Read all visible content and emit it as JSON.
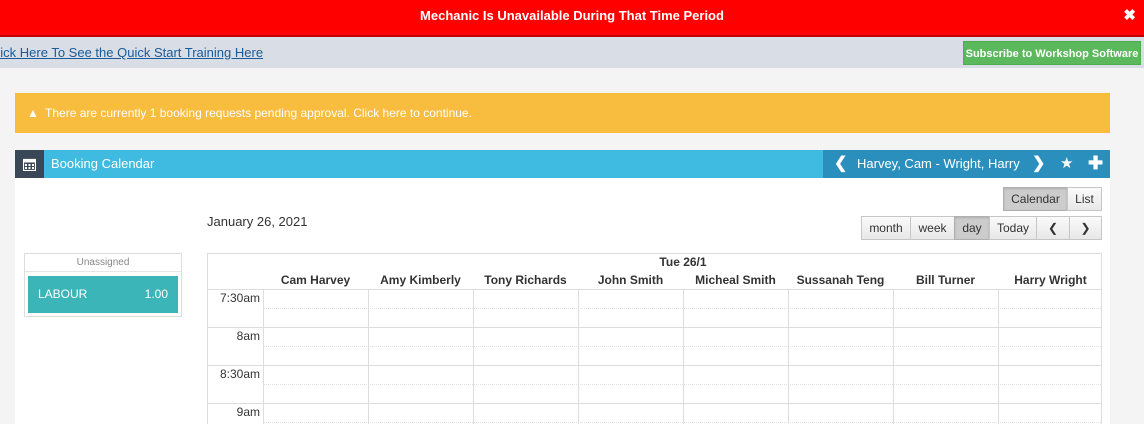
{
  "alert": {
    "message": "Mechanic Is Unavailable During That Time Period",
    "close_glyph": "✖"
  },
  "subbar": {
    "training_link": "Click Here To See the Quick Start Training Here",
    "subscribe_label": "Subscribe to Workshop Software"
  },
  "pending": {
    "icon": "warning-icon",
    "message": "There are currently 1 booking requests pending approval. Click here to continue."
  },
  "calendar_header": {
    "icon": "calendar-icon",
    "title": "Booking Calendar",
    "mechanics_label": "Harvey, Cam - Wright, Harry",
    "prev_glyph": "❮",
    "next_glyph": "❯",
    "star_glyph": "★",
    "plus_glyph": "✚"
  },
  "view_toggle": {
    "calendar": "Calendar",
    "list": "List",
    "active": "Calendar"
  },
  "range_buttons": {
    "month": "month",
    "week": "week",
    "day": "day",
    "today": "Today",
    "prev": "❮",
    "next": "❯",
    "active": "day"
  },
  "date_label": "January 26, 2021",
  "unassigned": {
    "title": "Unassigned",
    "item_label": "LABOUR",
    "item_hours": "1.00",
    "item_color": "#3bb5b8"
  },
  "grid": {
    "day_header": "Tue 26/1",
    "mechanics": [
      "Cam Harvey",
      "Amy Kimberly",
      "Tony Richards",
      "John Smith",
      "Micheal Smith",
      "Sussanah Teng",
      "Bill Turner",
      "Harry Wright"
    ],
    "times": [
      "7:30am",
      "8am",
      "8:30am",
      "9am"
    ]
  },
  "colors": {
    "alert": "#ff0000",
    "pending": "#f8bc3e",
    "header": "#3fbbe1",
    "header_nav": "#2b8fbd",
    "subscribe": "#5cb85c"
  }
}
